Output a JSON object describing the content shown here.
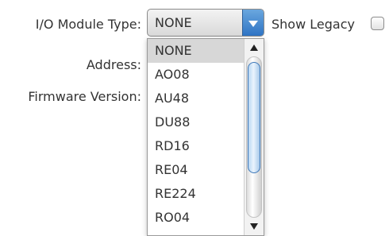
{
  "form": {
    "module_type_label": "I/O Module Type:",
    "address_label": "Address:",
    "firmware_label": "Firmware Version:",
    "show_legacy_label": "Show Legacy",
    "show_legacy_checked": false
  },
  "combo": {
    "selected_value": "NONE",
    "options": [
      "NONE",
      "AO08",
      "AU48",
      "DU88",
      "RD16",
      "RE04",
      "RE224",
      "RO04"
    ],
    "selected_index": 0
  },
  "colors": {
    "accent": "#2f74c4",
    "selected_row": "#d7d7d7"
  }
}
